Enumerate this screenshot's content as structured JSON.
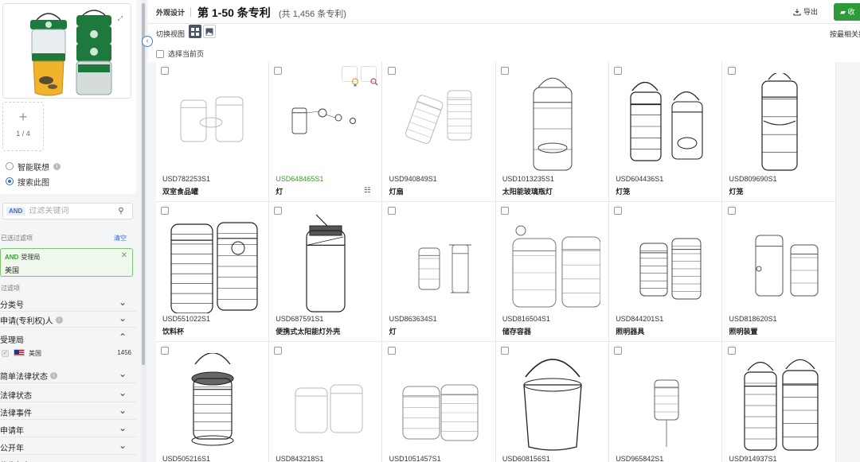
{
  "header": {
    "crumb": "外观设计",
    "title": "第 1-50 条专利",
    "subtitle": "(共 1,456 条专利)",
    "export_label": "导出",
    "green_btn_label": "收"
  },
  "toolbar": {
    "view_label": "切换视图",
    "sort_label": "按最相关排序",
    "select_page_label": "选择当前页"
  },
  "sidebar": {
    "image_counter": "1 / 4",
    "option_smart": "智能联想",
    "option_search_image": "搜索此图",
    "filter_and": "AND",
    "filter_placeholder": "过滤关键词",
    "selected_label": "已选过滤项",
    "clear_label": "清空",
    "chip_and": "AND",
    "chip_field": "受理局",
    "chip_value": "美国",
    "filters_label": "过滤项",
    "filter_rows": [
      {
        "label": "分类号",
        "info": false,
        "expanded": false
      },
      {
        "label": "申请(专利权)人",
        "info": true,
        "expanded": false
      },
      {
        "label": "受理局",
        "info": false,
        "expanded": true
      },
      {
        "label": "简单法律状态",
        "info": true,
        "expanded": false
      },
      {
        "label": "法律状态",
        "info": false,
        "expanded": false
      },
      {
        "label": "法律事件",
        "info": false,
        "expanded": false
      },
      {
        "label": "申请年",
        "info": false,
        "expanded": false
      },
      {
        "label": "公开年",
        "info": false,
        "expanded": false
      },
      {
        "label": "优先权年",
        "info": false,
        "expanded": false
      }
    ],
    "country": {
      "name": "美国",
      "count": "1456"
    }
  },
  "patents": [
    {
      "number": "USD782253S1",
      "name": "双室食品罐",
      "drawing": "two-jars"
    },
    {
      "number": "USD648465S1",
      "name": "灯",
      "drawing": "small-lamps",
      "highlighted": true
    },
    {
      "number": "USD940849S1",
      "name": "灯扇",
      "drawing": "two-cans"
    },
    {
      "number": "USD1013235S1",
      "name": "太阳能玻璃瓶灯",
      "drawing": "tall-jar"
    },
    {
      "number": "USD604436S1",
      "name": "灯笼",
      "drawing": "lanterns"
    },
    {
      "number": "USD809690S1",
      "name": "灯笼",
      "drawing": "tall-lantern"
    },
    {
      "number": "USD551022S1",
      "name": "饮料杯",
      "drawing": "cups"
    },
    {
      "number": "USD687591S1",
      "name": "便携式太阳能灯外壳",
      "drawing": "solar-jar"
    },
    {
      "number": "USD863634S1",
      "name": "灯",
      "drawing": "small-lanterns"
    },
    {
      "number": "USD816504S1",
      "name": "储存容器",
      "drawing": "containers"
    },
    {
      "number": "USD844201S1",
      "name": "照明器具",
      "drawing": "fixtures"
    },
    {
      "number": "USD818620S1",
      "name": "照明装置",
      "drawing": "lamp-pair"
    },
    {
      "number": "USD505216S1",
      "name": "",
      "drawing": "hanging-lantern"
    },
    {
      "number": "USD843218S1",
      "name": "",
      "drawing": "jars-faint"
    },
    {
      "number": "USD1051457S1",
      "name": "",
      "drawing": "camp-lanterns"
    },
    {
      "number": "USD608156S1",
      "name": "",
      "drawing": "bucket"
    },
    {
      "number": "USD965842S1",
      "name": "",
      "drawing": "stake-light"
    },
    {
      "number": "USD914937S1",
      "name": "",
      "drawing": "tall-pair"
    }
  ]
}
